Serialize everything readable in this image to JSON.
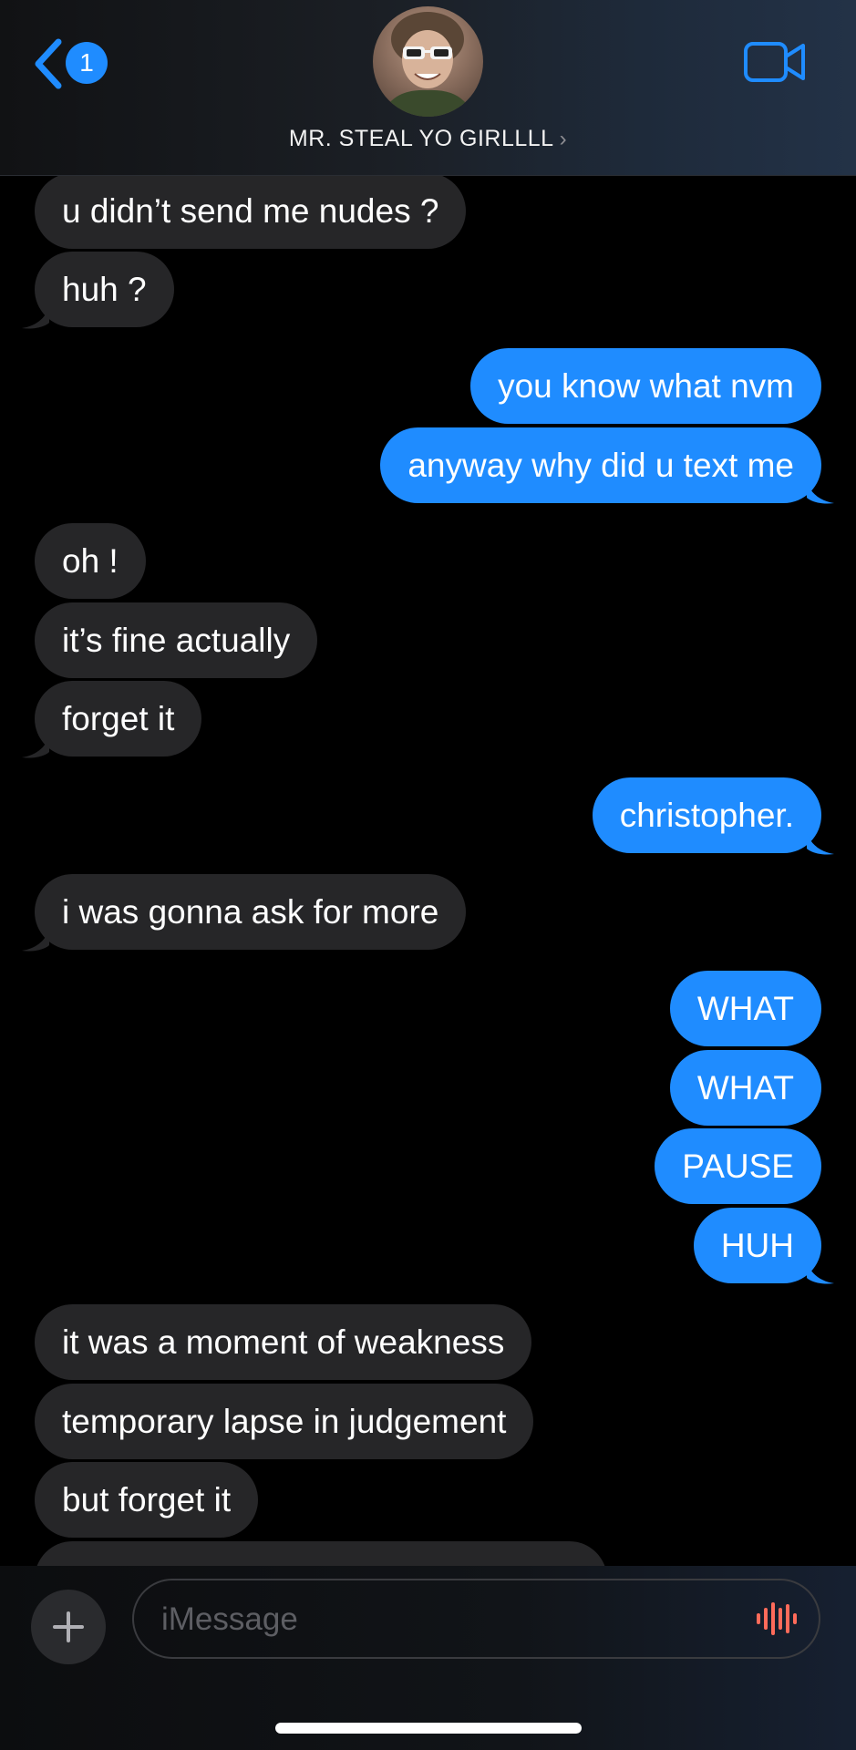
{
  "header": {
    "unread_count": "1",
    "contact_name": "MR. STEAL YO GIRLLLL",
    "chevron": "›"
  },
  "messages": [
    {
      "side": "in",
      "text": "u didn’t send me nudes ?"
    },
    {
      "side": "in",
      "text": "huh ?"
    },
    {
      "side": "out",
      "text": "you know what nvm"
    },
    {
      "side": "out",
      "text": "anyway why did u text me"
    },
    {
      "side": "in",
      "text": "oh !"
    },
    {
      "side": "in",
      "text": "it’s fine actually"
    },
    {
      "side": "in",
      "text": "forget it"
    },
    {
      "side": "out",
      "text": "christopher."
    },
    {
      "side": "in",
      "text": "i was gonna ask for more"
    },
    {
      "side": "out",
      "text": "WHAT"
    },
    {
      "side": "out",
      "text": "WHAT"
    },
    {
      "side": "out",
      "text": "PAUSE"
    },
    {
      "side": "out",
      "text": "HUH"
    },
    {
      "side": "in",
      "text": "it was a moment of weakness"
    },
    {
      "side": "in",
      "text": "temporary lapse in judgement"
    },
    {
      "side": "in",
      "text": "but forget it"
    },
    {
      "side": "in",
      "text": ""
    }
  ],
  "composer": {
    "placeholder": "iMessage"
  },
  "colors": {
    "accent": "#1f8cff",
    "incoming_bubble": "#262628",
    "audio_icon": "#ff6b5a"
  },
  "icons": {
    "back": "chevron-left-icon",
    "video": "video-camera-icon",
    "plus": "plus-icon",
    "audio": "waveform-icon"
  }
}
